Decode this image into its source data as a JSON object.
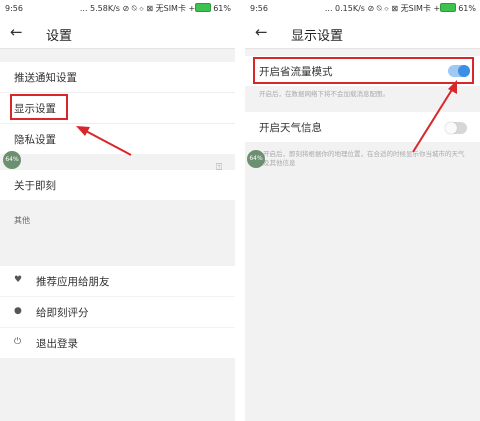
{
  "left": {
    "status": {
      "time": "9:56",
      "info": "... 5.58K/s ⊘ ⍉ ⌔ ⊠ 无SIM卡 +",
      "battery": "61%"
    },
    "appbar": {
      "back_icon": "arrow-left-icon",
      "back_glyph": "←",
      "title": "设置"
    },
    "items": {
      "push": "推送通知设置",
      "display": "显示设置",
      "privacy": "隐私设置",
      "about": "关于即刻"
    },
    "section_other": "其他",
    "other_items": [
      {
        "icon": "heart-icon",
        "glyph": "♥",
        "label": "推荐应用给朋友"
      },
      {
        "icon": "star-icon",
        "glyph": "●",
        "label": "给即刻评分"
      },
      {
        "icon": "power-icon",
        "glyph": "⏻",
        "label": "退出登录"
      }
    ],
    "badge": "64%",
    "side_glyph": "⍐"
  },
  "right": {
    "status": {
      "time": "9:56",
      "info": "... 0.15K/s ⊘ ⍉ ⌔ ⊠ 无SIM卡 +",
      "battery": "61%"
    },
    "appbar": {
      "back_icon": "arrow-left-icon",
      "back_glyph": "←",
      "title": "显示设置"
    },
    "data_saver": {
      "label": "开启省流量模式",
      "state": "on",
      "note": "开启后，在数据网络下将不会加载消息配图。"
    },
    "location": {
      "label": "开启天气信息",
      "state": "off",
      "note": "开启后，即刻将根据你的地理位置，在合适的时候显示你当城市的天气及其他信息"
    },
    "badge": "64%"
  },
  "colors": {
    "accent": "#3d8fe6",
    "highlight": "#d9262b",
    "badge": "#6c8f70"
  }
}
